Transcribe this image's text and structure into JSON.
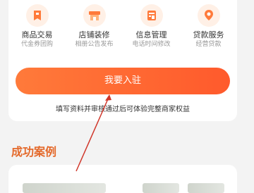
{
  "services": [
    {
      "title": "商品交易",
      "subtitle": "代金券团购",
      "icon": "tag-icon"
    },
    {
      "title": "店铺装修",
      "subtitle": "相册公告发布",
      "icon": "storefront-icon"
    },
    {
      "title": "信息管理",
      "subtitle": "电话时间修改",
      "icon": "form-icon"
    },
    {
      "title": "贷款服务",
      "subtitle": "经营贷款",
      "icon": "location-pin-icon"
    }
  ],
  "join_button": {
    "label": "我要入驻"
  },
  "tip": "填写资料并审核通过后可体验完整商家权益",
  "cases": {
    "title": "成功案例"
  },
  "colors": {
    "accent": "#ff5a2c",
    "section_title": "#e46a2c",
    "annotation_arrow": "#d0362a"
  }
}
